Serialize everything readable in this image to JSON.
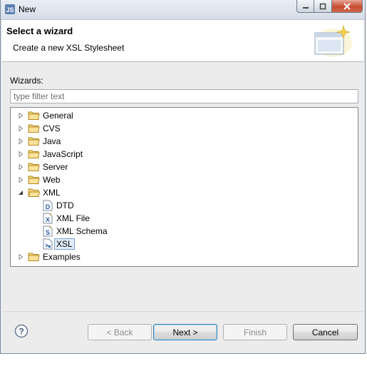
{
  "window": {
    "title": "New",
    "buttons": [
      "minimize",
      "maximize",
      "close"
    ]
  },
  "header": {
    "title": "Select a wizard",
    "subtitle": "Create a new XSL Stylesheet"
  },
  "wizards": {
    "label": "Wizards:",
    "filter_placeholder": "type filter text",
    "filter_value": ""
  },
  "tree": {
    "items": [
      {
        "label": "General",
        "level": 0,
        "kind": "folder",
        "expanded": false
      },
      {
        "label": "CVS",
        "level": 0,
        "kind": "folder",
        "expanded": false
      },
      {
        "label": "Java",
        "level": 0,
        "kind": "folder",
        "expanded": false
      },
      {
        "label": "JavaScript",
        "level": 0,
        "kind": "folder",
        "expanded": false
      },
      {
        "label": "Server",
        "level": 0,
        "kind": "folder",
        "expanded": false
      },
      {
        "label": "Web",
        "level": 0,
        "kind": "folder",
        "expanded": false
      },
      {
        "label": "XML",
        "level": 0,
        "kind": "folder",
        "expanded": true
      },
      {
        "label": "DTD",
        "level": 1,
        "kind": "dtd-file",
        "icon_letter": "D"
      },
      {
        "label": "XML File",
        "level": 1,
        "kind": "xml-file",
        "icon_letter": "X"
      },
      {
        "label": "XML Schema",
        "level": 1,
        "kind": "schema-file",
        "icon_letter": "S"
      },
      {
        "label": "XSL",
        "level": 1,
        "kind": "xsl-file",
        "selected": true
      },
      {
        "label": "Examples",
        "level": 0,
        "kind": "folder",
        "expanded": false
      }
    ]
  },
  "footer": {
    "back_label": "< Back",
    "next_label": "Next >",
    "finish_label": "Finish",
    "cancel_label": "Cancel",
    "back_enabled": false,
    "next_enabled": true,
    "finish_enabled": false,
    "cancel_enabled": true
  },
  "colors": {
    "selection_bg": "#e1ecfb",
    "selection_border": "#7da2ce",
    "folder": "#e8c25a",
    "close_button": "#c74c32"
  }
}
